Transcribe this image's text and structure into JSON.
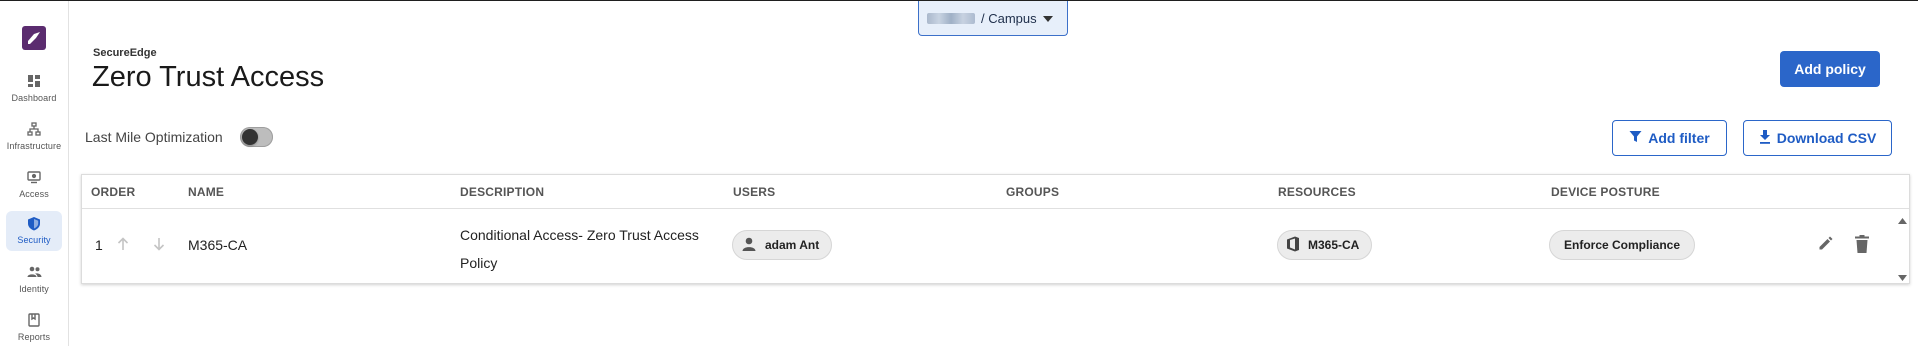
{
  "sidebar": {
    "items": [
      {
        "label": "Dashboard",
        "icon": "dashboard-icon"
      },
      {
        "label": "Infrastructure",
        "icon": "infrastructure-icon"
      },
      {
        "label": "Access",
        "icon": "access-icon"
      },
      {
        "label": "Security",
        "icon": "shield-icon",
        "active": true
      },
      {
        "label": "Identity",
        "icon": "people-icon"
      },
      {
        "label": "Reports",
        "icon": "book-icon"
      }
    ]
  },
  "workspace": {
    "label": "/ Campus"
  },
  "header": {
    "brand": "SecureEdge",
    "title": "Zero Trust Access",
    "add_policy_label": "Add policy"
  },
  "toolbar": {
    "last_mile_label": "Last Mile Optimization",
    "last_mile_enabled": false,
    "add_filter_label": "Add filter",
    "download_csv_label": "Download CSV"
  },
  "table": {
    "columns": [
      "ORDER",
      "NAME",
      "DESCRIPTION",
      "USERS",
      "GROUPS",
      "RESOURCES",
      "DEVICE POSTURE"
    ],
    "rows": [
      {
        "order": "1",
        "name": "M365-CA",
        "description": "Conditional Access- Zero Trust Access Policy",
        "users": "adam Ant",
        "groups": "",
        "resources": "M365-CA",
        "device_posture": "Enforce Compliance"
      }
    ]
  },
  "colors": {
    "accent": "#2b66c9",
    "logo": "#5b2c6f",
    "active_nav_bg": "#e4ecf8"
  }
}
